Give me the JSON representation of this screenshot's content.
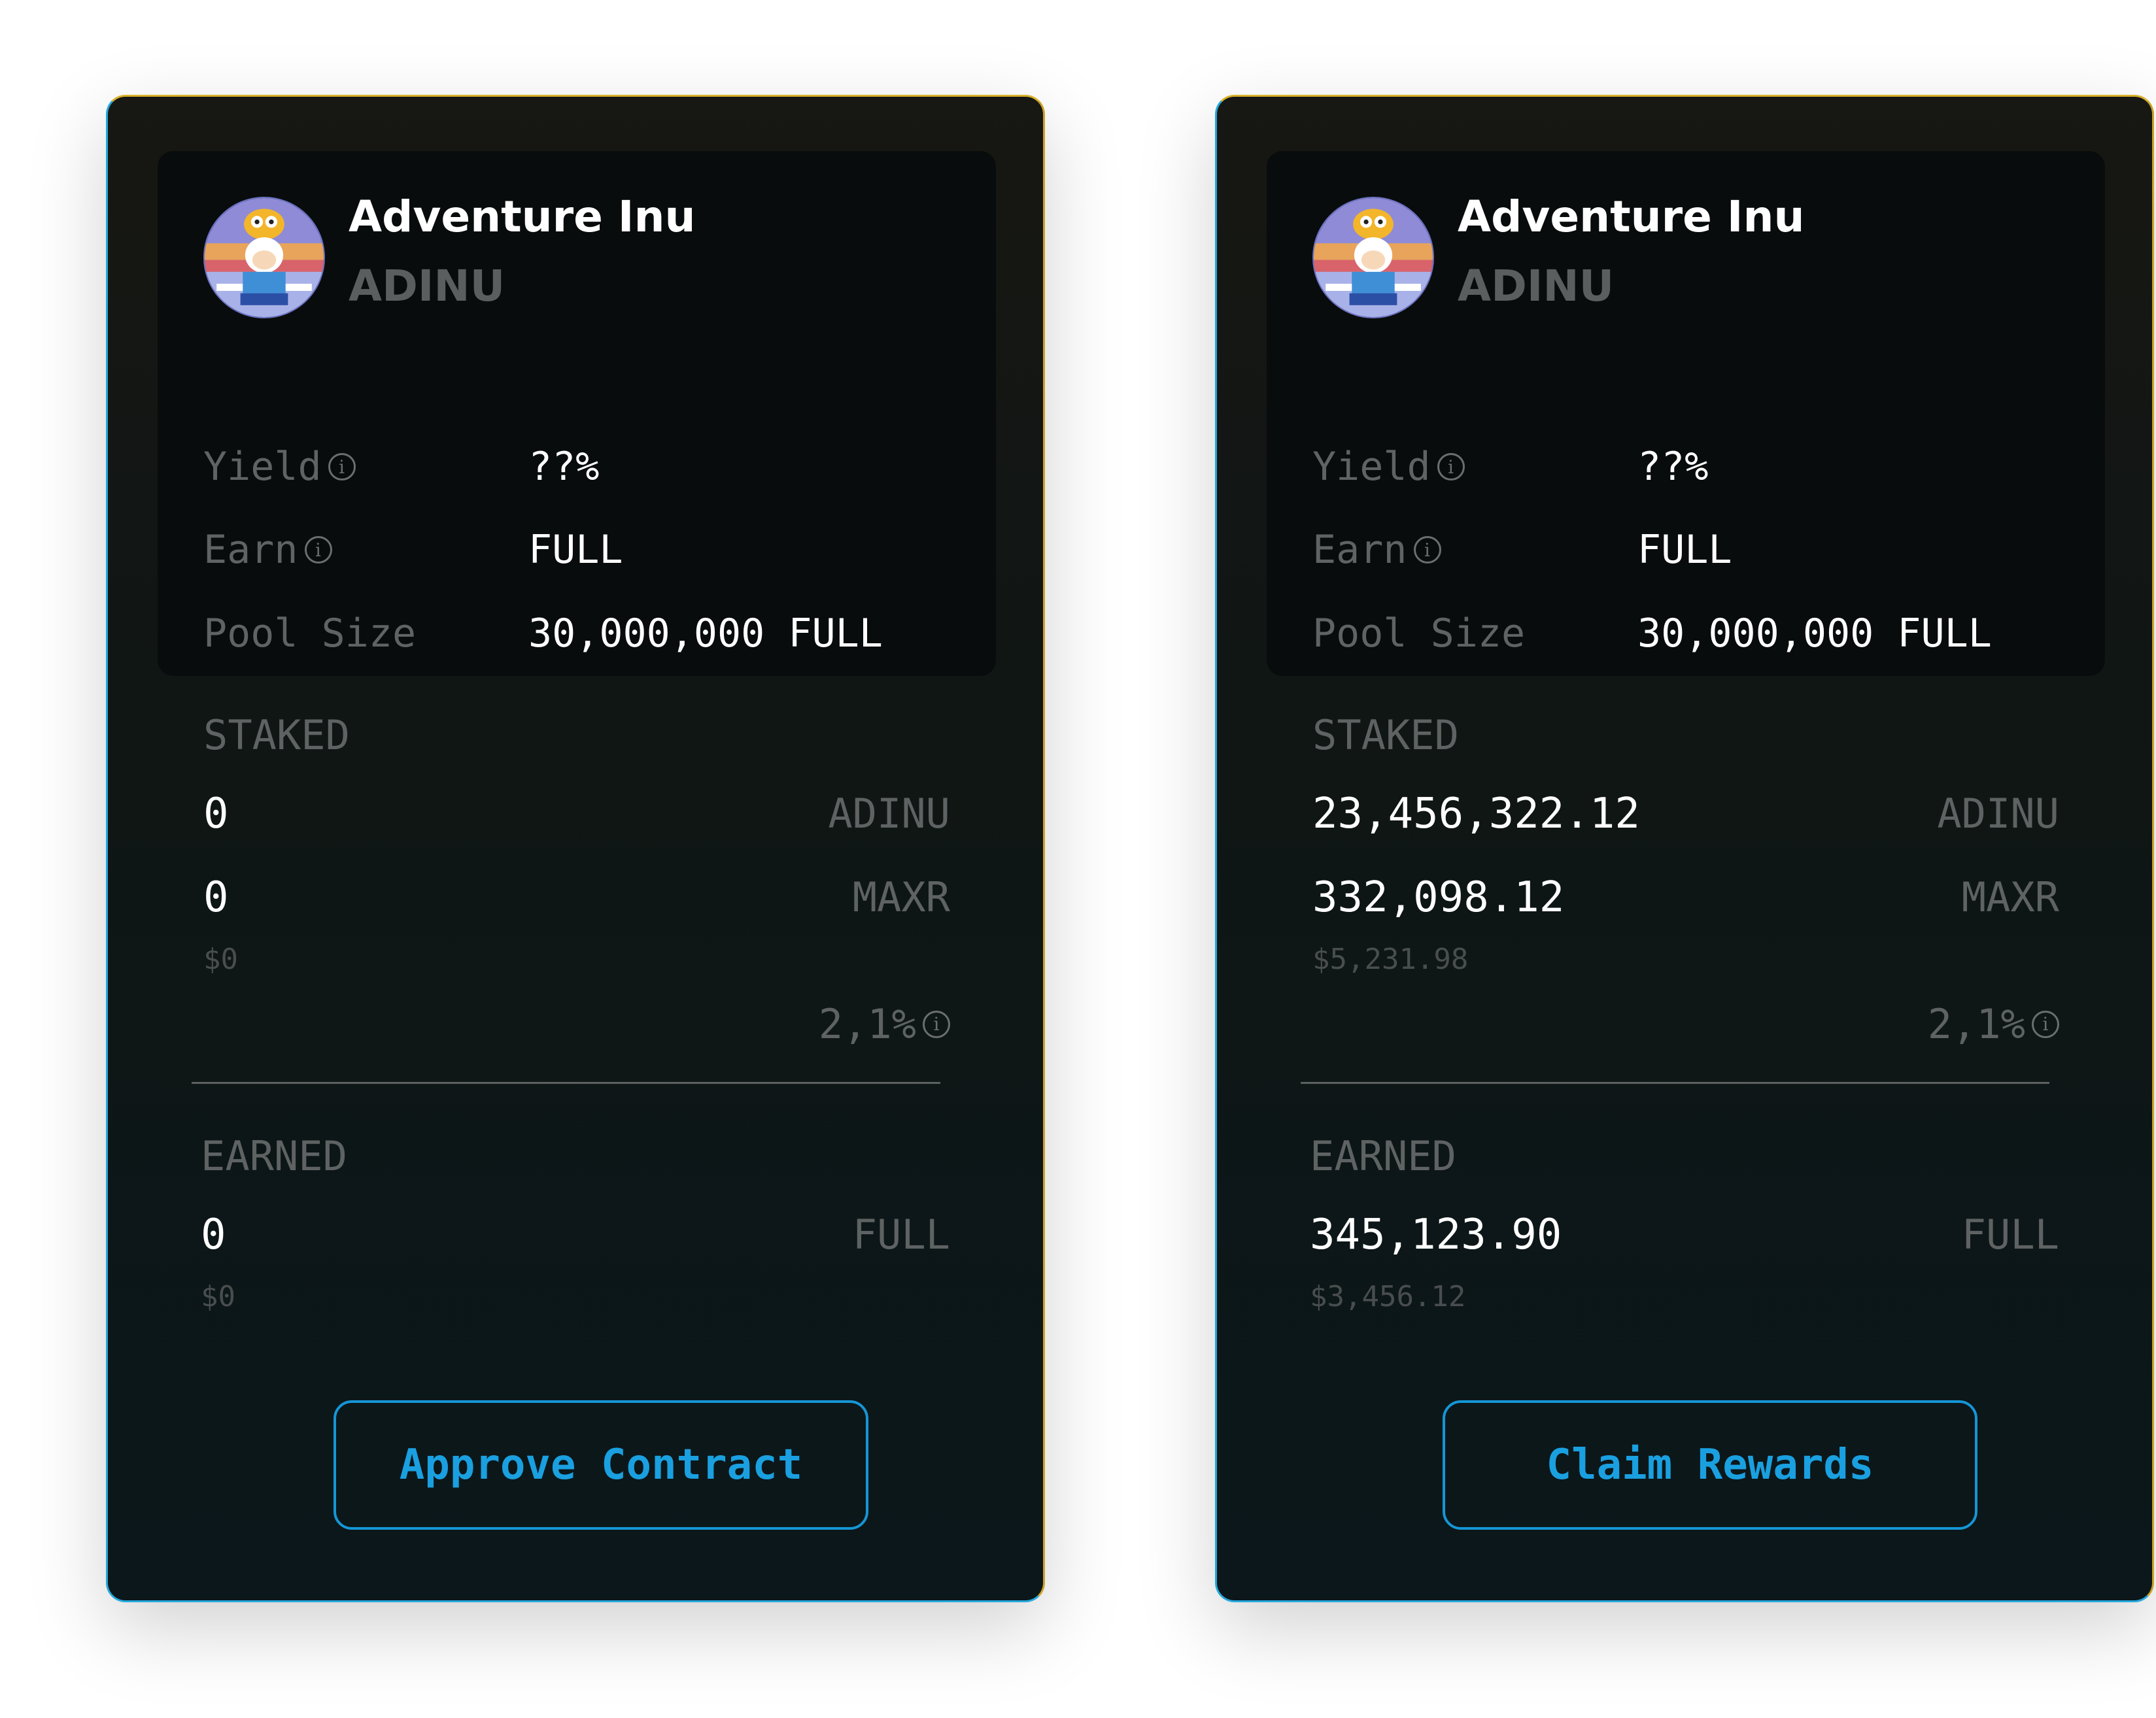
{
  "colors": {
    "card_bg_top": "#171713",
    "card_bg_bottom": "#0b171b",
    "border_gold": "#d8b02c",
    "border_blue": "#24a8dc",
    "button_blue": "#1aa0e0",
    "muted_text": "#5e6262",
    "value_text": "#ffffff"
  },
  "cards": [
    {
      "token": {
        "name": "Adventure Inu",
        "symbol": "ADINU",
        "avatar_icon": "adventure-inu-avatar-icon"
      },
      "stats": {
        "yield_label": "Yield",
        "yield_value": "??%",
        "earn_label": "Earn",
        "earn_value": "FULL",
        "pool_label": "Pool Size",
        "pool_value": "30,000,000 FULL"
      },
      "staked": {
        "label": "STAKED",
        "primary_amount": "0",
        "primary_unit": "ADINU",
        "secondary_amount": "0",
        "secondary_unit": "MAXR",
        "usd": "$0",
        "percent": "2,1%"
      },
      "earned": {
        "label": "EARNED",
        "amount": "0",
        "unit": "FULL",
        "usd": "$0"
      },
      "button_label": "Approve Contract"
    },
    {
      "token": {
        "name": "Adventure Inu",
        "symbol": "ADINU",
        "avatar_icon": "adventure-inu-avatar-icon"
      },
      "stats": {
        "yield_label": "Yield",
        "yield_value": "??%",
        "earn_label": "Earn",
        "earn_value": "FULL",
        "pool_label": "Pool Size",
        "pool_value": "30,000,000 FULL"
      },
      "staked": {
        "label": "STAKED",
        "primary_amount": "23,456,322.12",
        "primary_unit": "ADINU",
        "secondary_amount": "332,098.12",
        "secondary_unit": "MAXR",
        "usd": "$5,231.98",
        "percent": "2,1%"
      },
      "earned": {
        "label": "EARNED",
        "amount": "345,123.90",
        "unit": "FULL",
        "usd": "$3,456.12"
      },
      "button_label": "Claim Rewards"
    }
  ]
}
